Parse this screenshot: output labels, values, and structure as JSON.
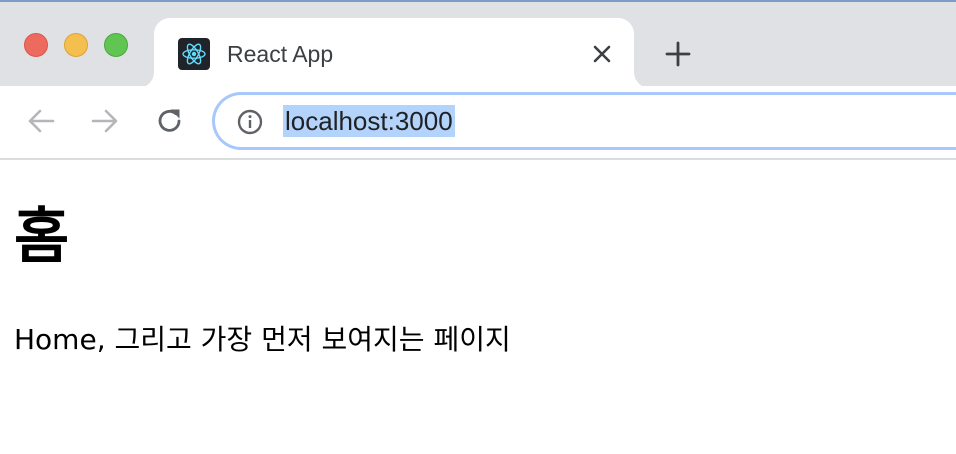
{
  "browser": {
    "tab": {
      "title": "React App",
      "favicon": "react-logo-icon"
    },
    "new_tab_icon": "plus-icon",
    "toolbar": {
      "back_icon": "back-arrow-icon",
      "forward_icon": "forward-arrow-icon",
      "reload_icon": "reload-icon",
      "site_info_icon": "info-icon",
      "url": "localhost:3000"
    }
  },
  "page": {
    "heading": "홈",
    "paragraph": "Home, 그리고 가장 먼저 보여지는 페이지"
  },
  "colors": {
    "tabstrip": "#dfe1e5",
    "omnibox_border": "#a8c7fa",
    "url_selection": "#b4d3fb",
    "react_blue": "#61dafb"
  }
}
